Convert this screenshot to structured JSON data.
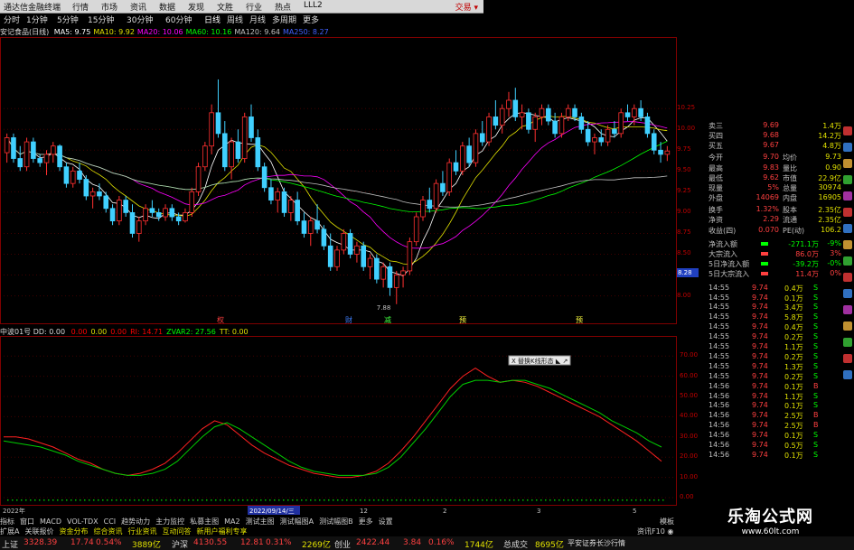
{
  "window": {
    "app_title": "通达信金融终端",
    "top_right": "交易 ▾"
  },
  "menu": [
    "行情",
    "市场",
    "资讯",
    "数据",
    "发现",
    "文胜",
    "行业",
    "热点",
    "LLL2"
  ],
  "periods": [
    "分时",
    "1分钟",
    "5分钟",
    "15分钟",
    "30分钟",
    "60分钟",
    "日线",
    "周线",
    "月线",
    "多周期",
    "更多"
  ],
  "ma_legend": {
    "name": "安记食品(日线)",
    "items": [
      {
        "label": "MA5: 9.75",
        "color": "#ffffff"
      },
      {
        "label": "MA10: 9.92",
        "color": "#e0e000"
      },
      {
        "label": "MA20: 10.06",
        "color": "#ff00ff"
      },
      {
        "label": "MA60: 10.16",
        "color": "#00ff00"
      },
      {
        "label": "MA120: 9.64",
        "color": "#c0c0c0"
      },
      {
        "label": "MA250: 8.27",
        "color": "#4060ff"
      }
    ]
  },
  "price_axis": [
    "10.25",
    "10.00",
    "9.75",
    "9.50",
    "9.25",
    "9.00",
    "8.75",
    "8.50",
    "8.25",
    "8.00"
  ],
  "price_marker": "8.28",
  "low_label": "7.88",
  "event_markers": [
    "权",
    "财",
    "减",
    "预",
    "预"
  ],
  "quote": {
    "rows": [
      {
        "l": "卖三",
        "v": "9.69",
        "l2": "",
        "v2": "1.4万"
      },
      {
        "l": "买四",
        "v": "9.68",
        "l2": "",
        "v2": "14.2万"
      },
      {
        "l": "买五",
        "v": "9.67",
        "l2": "",
        "v2": "4.8万"
      },
      {
        "l": "今开",
        "v": "9.70",
        "l2": "均价",
        "v2": "9.73"
      },
      {
        "l": "最高",
        "v": "9.83",
        "l2": "量比",
        "v2": "0.90"
      },
      {
        "l": "最低",
        "v": "9.62",
        "l2": "市值",
        "v2": "22.9亿"
      },
      {
        "l": "现量",
        "v": "5%",
        "l2": "总量",
        "v2": "30974"
      },
      {
        "l": "外盘",
        "v": "14069",
        "l2": "内盘",
        "v2": "16905"
      },
      {
        "l": "换手",
        "v": "1.32%",
        "l2": "股本",
        "v2": "2.35亿"
      },
      {
        "l": "净资",
        "v": "2.29",
        "l2": "流通",
        "v2": "2.35亿"
      },
      {
        "l": "收益(四)",
        "v": "0.070",
        "l2": "PE(动)",
        "v2": "106.2"
      }
    ],
    "flow": [
      {
        "l": "净流入额",
        "v": "-271.1万",
        "c": "#00ff00",
        "pct": "-9%"
      },
      {
        "l": "大宗流入",
        "v": "86.0万",
        "c": "#ff4040",
        "pct": "3%"
      },
      {
        "l": "5日净流入额",
        "v": "-39.2万",
        "c": "#00ff00",
        "pct": "-0%"
      },
      {
        "l": "5日大宗流入",
        "v": "11.4万",
        "c": "#ff4040",
        "pct": "0%"
      }
    ],
    "ticks": [
      {
        "t": "14:55",
        "p": "9.74",
        "n": "0.4万",
        "s": "S"
      },
      {
        "t": "14:55",
        "p": "9.74",
        "n": "0.1万",
        "s": "S"
      },
      {
        "t": "14:55",
        "p": "9.74",
        "n": "3.4万",
        "s": "S"
      },
      {
        "t": "14:55",
        "p": "9.74",
        "n": "5.8万",
        "s": "S"
      },
      {
        "t": "14:55",
        "p": "9.74",
        "n": "0.4万",
        "s": "S"
      },
      {
        "t": "14:55",
        "p": "9.74",
        "n": "0.2万",
        "s": "S"
      },
      {
        "t": "14:55",
        "p": "9.74",
        "n": "1.1万",
        "s": "S"
      },
      {
        "t": "14:55",
        "p": "9.74",
        "n": "0.2万",
        "s": "S"
      },
      {
        "t": "14:55",
        "p": "9.74",
        "n": "1.3万",
        "s": "S"
      },
      {
        "t": "14:55",
        "p": "9.74",
        "n": "0.2万",
        "s": "S"
      },
      {
        "t": "14:56",
        "p": "9.74",
        "n": "0.1万",
        "s": "B"
      },
      {
        "t": "14:56",
        "p": "9.74",
        "n": "1.1万",
        "s": "S"
      },
      {
        "t": "14:56",
        "p": "9.74",
        "n": "0.1万",
        "s": "S"
      },
      {
        "t": "14:56",
        "p": "9.74",
        "n": "2.5万",
        "s": "B"
      },
      {
        "t": "14:56",
        "p": "9.74",
        "n": "2.5万",
        "s": "B"
      },
      {
        "t": "14:56",
        "p": "9.74",
        "n": "0.1万",
        "s": "S"
      },
      {
        "t": "14:56",
        "p": "9.74",
        "n": "0.5万",
        "s": "S"
      },
      {
        "t": "14:56",
        "p": "9.74",
        "n": "0.1万",
        "s": "S"
      }
    ]
  },
  "indicator_legend": {
    "name": "中波01号 DD: 0.00",
    "items": [
      {
        "label": "0.00",
        "color": "#ff0000"
      },
      {
        "label": "0.00",
        "color": "#e0e000"
      },
      {
        "label": "0.00",
        "color": "#ff0000"
      },
      {
        "label": "RI: 14.71",
        "color": "#ff0000"
      },
      {
        "label": "ZVAR2: 27.56",
        "color": "#00ff00"
      },
      {
        "label": "TT: 0.00",
        "color": "#e0e000"
      }
    ]
  },
  "indicator_axis": [
    "70.00",
    "60.00",
    "50.00",
    "40.00",
    "30.00",
    "20.00",
    "10.00",
    "0.00"
  ],
  "indicator_tooltip": "X 替换K线形态 ◣ ↗",
  "date_axis": {
    "start": "2022年",
    "highlight": "2022/09/14/三",
    "labels": [
      "12",
      "2",
      "3",
      "5"
    ]
  },
  "tabs": [
    "指标",
    "窗口",
    "MACD",
    "VOL-TDX",
    "CCI",
    "趋势动力",
    "主力监控",
    "私募主图",
    "MA2",
    "测试主图",
    "测试幅图A",
    "测试幅图B",
    "更多",
    "设置"
  ],
  "tabs_right": "模板",
  "tabs2": [
    "扩展A",
    "关联报价",
    "资金分布",
    "综合资讯",
    "行业资讯",
    "互动问答",
    "新用户福利专享"
  ],
  "tabs2_right": "资讯F10 ◉",
  "status": [
    {
      "label": "上证",
      "v": "3328.39",
      "c": "17.74",
      "p": "0.54%",
      "amt": "3889亿"
    },
    {
      "label": "沪深",
      "v": "4130.55",
      "c": "12.81",
      "p": "0.31%",
      "amt": "2269亿"
    },
    {
      "label": "创业",
      "v": "2422.44",
      "c": "3.84",
      "p": "0.16%",
      "amt": "1744亿"
    }
  ],
  "status_total": {
    "label": "总成交",
    "v": "8695亿"
  },
  "status_broker": "平安证券长沙行情",
  "watermark": {
    "zh": "乐淘公式网",
    "url": "www.60lt.com"
  },
  "chart_data": {
    "type": "candlestick",
    "panels": [
      {
        "name": "price",
        "ylim": [
          7.8,
          10.35
        ],
        "candles": [
          [
            9.72,
            9.95,
            9.6,
            9.9
          ],
          [
            9.9,
            9.95,
            9.6,
            9.65
          ],
          [
            9.65,
            9.8,
            9.5,
            9.55
          ],
          [
            9.55,
            9.9,
            9.5,
            9.85
          ],
          [
            9.85,
            9.9,
            9.6,
            9.65
          ],
          [
            9.65,
            9.7,
            9.55,
            9.6
          ],
          [
            9.6,
            9.75,
            9.45,
            9.7
          ],
          [
            9.7,
            9.85,
            9.6,
            9.8
          ],
          [
            9.8,
            9.82,
            9.5,
            9.55
          ],
          [
            9.55,
            9.6,
            9.3,
            9.35
          ],
          [
            9.35,
            9.55,
            9.3,
            9.5
          ],
          [
            9.5,
            9.6,
            9.35,
            9.4
          ],
          [
            9.4,
            9.45,
            9.15,
            9.2
          ],
          [
            9.2,
            9.3,
            9.05,
            9.25
          ],
          [
            9.25,
            9.35,
            9.15,
            9.2
          ],
          [
            9.2,
            9.25,
            9.0,
            9.05
          ],
          [
            9.05,
            9.1,
            8.85,
            8.9
          ],
          [
            8.9,
            9.2,
            8.85,
            9.15
          ],
          [
            9.15,
            9.2,
            8.95,
            9.0
          ],
          [
            9.0,
            9.1,
            8.7,
            8.75
          ],
          [
            8.75,
            8.95,
            8.65,
            8.9
          ],
          [
            8.9,
            9.1,
            8.85,
            9.05
          ],
          [
            9.05,
            9.15,
            8.95,
            9.0
          ],
          [
            9.0,
            9.05,
            8.9,
            8.95
          ],
          [
            8.95,
            9.1,
            8.9,
            9.05
          ],
          [
            9.05,
            9.1,
            8.9,
            8.95
          ],
          [
            8.95,
            9.0,
            8.85,
            8.9
          ],
          [
            8.9,
            9.05,
            8.88,
            9.0
          ],
          [
            9.0,
            9.3,
            8.95,
            9.25
          ],
          [
            9.25,
            9.6,
            9.2,
            9.55
          ],
          [
            9.55,
            9.85,
            9.5,
            9.8
          ],
          [
            9.8,
            10.3,
            9.7,
            10.2
          ],
          [
            10.2,
            10.6,
            9.9,
            9.95
          ],
          [
            9.95,
            10.1,
            9.5,
            9.55
          ],
          [
            9.55,
            9.9,
            9.4,
            9.85
          ],
          [
            9.85,
            10.0,
            9.6,
            9.65
          ],
          [
            9.65,
            10.2,
            9.6,
            10.15
          ],
          [
            10.15,
            10.3,
            9.85,
            9.9
          ],
          [
            9.9,
            10.0,
            9.5,
            9.55
          ],
          [
            9.55,
            9.6,
            9.25,
            9.3
          ],
          [
            9.3,
            9.4,
            9.1,
            9.15
          ],
          [
            9.15,
            9.3,
            9.0,
            9.25
          ],
          [
            9.25,
            9.3,
            8.95,
            9.0
          ],
          [
            9.0,
            9.2,
            8.9,
            9.15
          ],
          [
            9.15,
            9.25,
            8.85,
            8.9
          ],
          [
            8.9,
            9.0,
            8.7,
            8.75
          ],
          [
            8.75,
            8.95,
            8.6,
            8.9
          ],
          [
            8.9,
            9.1,
            8.75,
            8.8
          ],
          [
            8.8,
            8.85,
            8.55,
            8.6
          ],
          [
            8.6,
            8.75,
            8.3,
            8.35
          ],
          [
            8.35,
            8.6,
            8.3,
            8.55
          ],
          [
            8.55,
            8.8,
            8.5,
            8.75
          ],
          [
            8.75,
            8.8,
            8.45,
            8.5
          ],
          [
            8.5,
            8.65,
            8.4,
            8.6
          ],
          [
            8.6,
            8.65,
            8.3,
            8.35
          ],
          [
            8.35,
            8.5,
            8.2,
            8.45
          ],
          [
            8.45,
            8.5,
            8.15,
            8.2
          ],
          [
            8.2,
            8.4,
            8.1,
            8.35
          ],
          [
            8.35,
            8.4,
            8.0,
            8.1
          ],
          [
            8.1,
            8.3,
            7.9,
            8.25
          ],
          [
            8.25,
            8.35,
            8.1,
            8.3
          ],
          [
            8.3,
            8.7,
            8.25,
            8.65
          ],
          [
            8.65,
            9.0,
            8.6,
            8.95
          ],
          [
            8.95,
            9.2,
            8.9,
            9.15
          ],
          [
            9.15,
            9.3,
            9.0,
            9.05
          ],
          [
            9.05,
            9.4,
            9.0,
            9.35
          ],
          [
            9.35,
            9.5,
            9.2,
            9.25
          ],
          [
            9.25,
            9.65,
            9.2,
            9.6
          ],
          [
            9.6,
            9.75,
            9.45,
            9.5
          ],
          [
            9.5,
            9.85,
            9.45,
            9.8
          ],
          [
            9.8,
            9.9,
            9.55,
            9.6
          ],
          [
            9.6,
            10.0,
            9.55,
            9.95
          ],
          [
            9.95,
            10.1,
            9.8,
            9.85
          ],
          [
            9.85,
            10.2,
            9.8,
            10.15
          ],
          [
            10.15,
            10.35,
            10.0,
            10.05
          ],
          [
            10.05,
            10.3,
            9.95,
            10.25
          ],
          [
            10.25,
            10.45,
            10.15,
            10.35
          ],
          [
            10.35,
            10.5,
            10.1,
            10.15
          ],
          [
            10.15,
            10.3,
            10.0,
            10.2
          ],
          [
            10.2,
            10.25,
            9.95,
            10.0
          ],
          [
            10.0,
            10.2,
            9.85,
            10.15
          ],
          [
            10.15,
            10.3,
            10.05,
            10.25
          ],
          [
            10.25,
            10.3,
            10.05,
            10.1
          ],
          [
            10.1,
            10.2,
            9.9,
            9.95
          ],
          [
            9.95,
            10.2,
            9.9,
            10.15
          ],
          [
            10.15,
            10.3,
            10.1,
            10.25
          ],
          [
            10.25,
            10.3,
            10.1,
            10.15
          ],
          [
            10.15,
            10.2,
            9.95,
            10.0
          ],
          [
            10.0,
            10.1,
            9.8,
            9.85
          ],
          [
            9.85,
            9.95,
            9.7,
            9.9
          ],
          [
            9.9,
            10.0,
            9.8,
            9.85
          ],
          [
            9.85,
            10.05,
            9.8,
            10.0
          ],
          [
            10.0,
            10.1,
            9.9,
            9.95
          ],
          [
            9.95,
            10.25,
            9.9,
            10.2
          ],
          [
            10.2,
            10.3,
            10.1,
            10.15
          ],
          [
            10.15,
            10.3,
            10.05,
            10.25
          ],
          [
            10.25,
            10.35,
            10.1,
            10.15
          ],
          [
            10.15,
            10.2,
            9.9,
            9.95
          ],
          [
            9.95,
            10.0,
            9.7,
            9.75
          ],
          [
            9.75,
            9.85,
            9.6,
            9.7
          ],
          [
            9.7,
            9.8,
            9.62,
            9.74
          ]
        ]
      },
      {
        "name": "indicator",
        "ylim": [
          0,
          75
        ],
        "series": [
          {
            "name": "RI",
            "color": "#ff2020",
            "values": [
              30,
              30,
              29,
              27,
              25,
              22,
              19,
              17,
              14,
              12,
              11,
              12,
              14,
              17,
              22,
              28,
              34,
              38,
              36,
              31,
              26,
              22,
              19,
              16,
              14,
              12,
              11,
              10,
              10,
              11,
              13,
              17,
              23,
              30,
              38,
              46,
              54,
              60,
              64,
              60,
              57,
              58,
              57,
              55,
              52,
              49,
              46,
              43,
              40,
              36,
              32,
              28,
              23,
              18
            ]
          },
          {
            "name": "ZVAR2",
            "color": "#00cc00",
            "values": [
              28,
              27,
              26,
              25,
              23,
              21,
              18,
              16,
              14,
              12,
              11,
              11,
              12,
              14,
              18,
              24,
              30,
              35,
              37,
              34,
              30,
              26,
              22,
              18,
              15,
              13,
              12,
              11,
              11,
              11,
              12,
              15,
              20,
              27,
              34,
              42,
              50,
              56,
              58,
              58,
              57,
              58,
              58,
              56,
              54,
              51,
              48,
              45,
              42,
              38,
              35,
              32,
              28,
              25
            ]
          }
        ]
      }
    ]
  }
}
